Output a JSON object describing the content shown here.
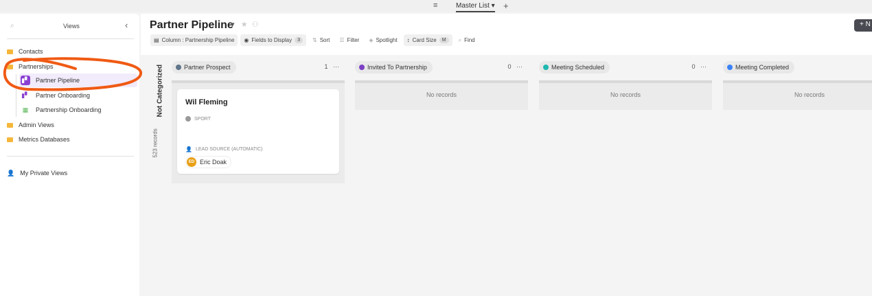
{
  "topbar": {
    "menu_icon": "hamburger-icon",
    "list": "Master List ▾",
    "plus": "+"
  },
  "sidebar": {
    "title": "Views",
    "search_icon": "search-icon",
    "collapse": "‹",
    "items": [
      {
        "label": "Contacts"
      },
      {
        "label": "Partnerships"
      },
      {
        "label": "Partner Pipeline"
      },
      {
        "label": "Partner Onboarding"
      },
      {
        "label": "Partnership Onboarding"
      },
      {
        "label": "Admin Views"
      },
      {
        "label": "Metrics Databases"
      }
    ],
    "private": "My Private Views"
  },
  "header": {
    "title": "Partner Pipeline",
    "title_caret": "▾",
    "star": "★",
    "new_label": "+ N",
    "toolbar": {
      "column": "Column : Partnership Pipeline",
      "fields": "Fields to Display",
      "fields_count": "3",
      "sort": "Sort",
      "filter": "Filter",
      "spotlight": "Spotlight",
      "card_size": "Card Size",
      "card_size_value": "M",
      "find": "Find"
    }
  },
  "uncategorized": {
    "label": "Not Categorized",
    "records": "523 records"
  },
  "columns": [
    {
      "name": "Partner Prospect",
      "count": "1",
      "color": "#607589"
    },
    {
      "name": "Invited To Partnership",
      "count": "0",
      "color": "#7b3fc4",
      "empty": "No records"
    },
    {
      "name": "Meeting Scheduled",
      "count": "0",
      "color": "#1fb8b0",
      "empty": "No records"
    },
    {
      "name": "Meeting Completed",
      "color": "#3b82f6",
      "empty": "No records"
    }
  ],
  "card": {
    "name": "Wil Fleming",
    "field1": "SPORT",
    "field2": "LEAD SOURCE (AUTOMATIC)",
    "person": "Eric Doak",
    "initials": "ED"
  },
  "more": "···"
}
